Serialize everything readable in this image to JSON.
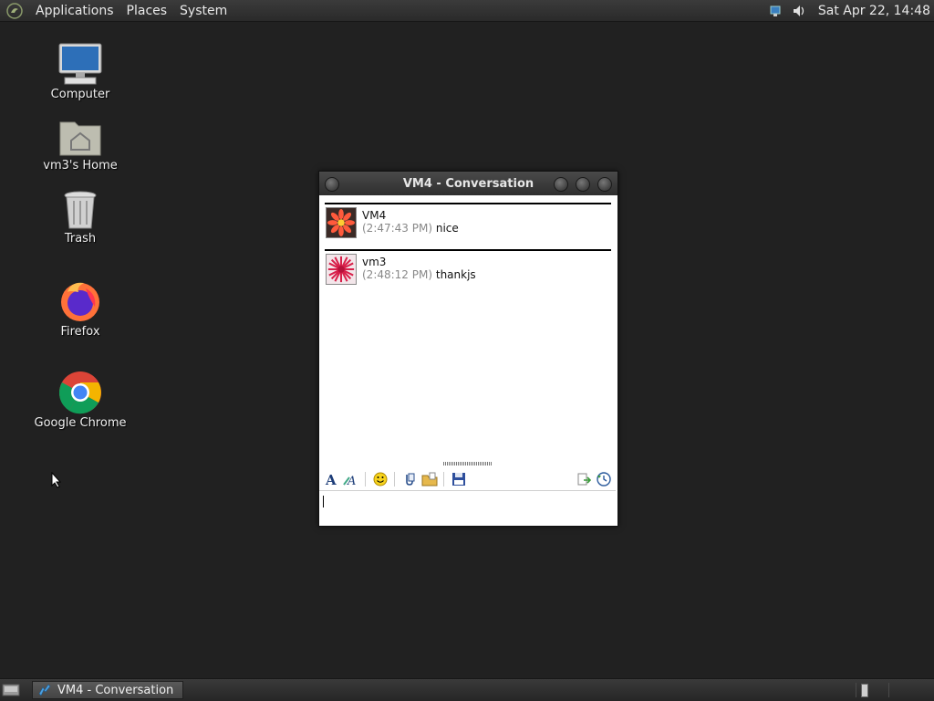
{
  "top_panel": {
    "menus": [
      "Applications",
      "Places",
      "System"
    ],
    "clock": "Sat Apr 22, 14:48",
    "tray": [
      "network-icon",
      "volume-icon"
    ]
  },
  "desktop": {
    "icons": [
      {
        "label": "Computer",
        "icon": "computer-icon"
      },
      {
        "label": "vm3's Home",
        "icon": "home-folder-icon"
      },
      {
        "label": "Trash",
        "icon": "trash-icon"
      },
      {
        "label": "Firefox",
        "icon": "firefox-icon"
      },
      {
        "label": "Google Chrome",
        "icon": "chrome-icon"
      }
    ]
  },
  "window": {
    "title": "VM4 - Conversation",
    "messages": [
      {
        "sender": "VM4",
        "time": "(2:47:43 PM)",
        "text": "nice",
        "avatar": "flower-avatar"
      },
      {
        "sender": "vm3",
        "time": "(2:48:12 PM)",
        "text": "thankjs",
        "avatar": "star-avatar"
      }
    ],
    "toolbar": [
      "font-icon",
      "font-style-icon",
      "smiley-icon",
      "attach-icon",
      "folder-icon",
      "save-icon",
      "copy-icon",
      "history-icon"
    ],
    "input_value": ""
  },
  "taskbar": {
    "tasks": [
      {
        "label": "VM4 - Conversation",
        "icon": "messenger-icon"
      }
    ]
  },
  "colors": {
    "desktop_bg": "#212121",
    "panel_bg": "#2f2f2f",
    "titlebar_bg": "#3a3a3a",
    "timestamp": "#888888"
  }
}
